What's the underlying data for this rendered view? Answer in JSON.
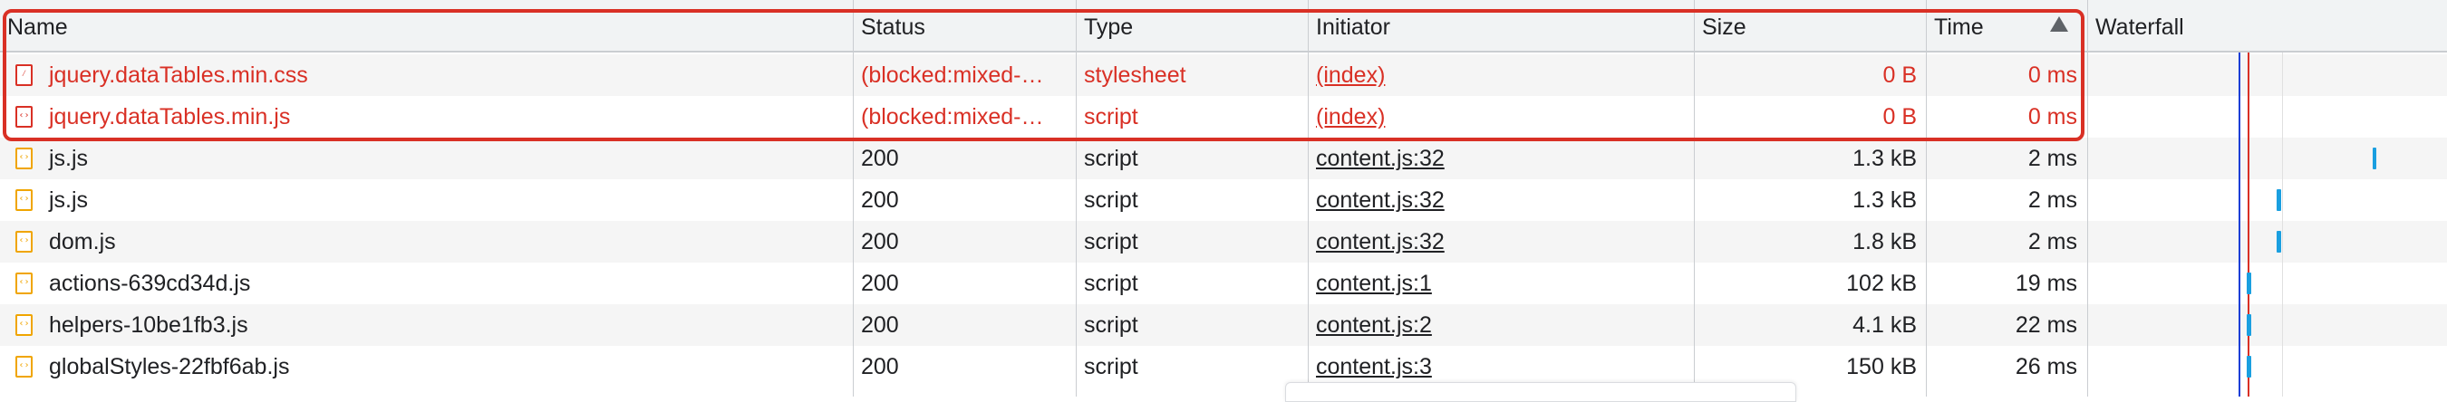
{
  "columns": {
    "name": "Name",
    "status": "Status",
    "type": "Type",
    "initiator": "Initiator",
    "size": "Size",
    "time": "Time",
    "waterfall": "Waterfall"
  },
  "rows": [
    {
      "name": "jquery.dataTables.min.css",
      "status": "(blocked:mixed-…",
      "type": "stylesheet",
      "initiator": "(index)",
      "size": "0 B",
      "time": "0 ms",
      "icon": "css-file-icon",
      "error": true
    },
    {
      "name": "jquery.dataTables.min.js",
      "status": "(blocked:mixed-…",
      "type": "script",
      "initiator": "(index)",
      "size": "0 B",
      "time": "0 ms",
      "icon": "js-file-icon",
      "error": true
    },
    {
      "name": "js.js",
      "status": "200",
      "type": "script",
      "initiator": "content.js:32",
      "size": "1.3 kB",
      "time": "2 ms",
      "icon": "js-file-icon",
      "error": false
    },
    {
      "name": "js.js",
      "status": "200",
      "type": "script",
      "initiator": "content.js:32",
      "size": "1.3 kB",
      "time": "2 ms",
      "icon": "js-file-icon",
      "error": false
    },
    {
      "name": "dom.js",
      "status": "200",
      "type": "script",
      "initiator": "content.js:32",
      "size": "1.8 kB",
      "time": "2 ms",
      "icon": "js-file-icon",
      "error": false
    },
    {
      "name": "actions-639cd34d.js",
      "status": "200",
      "type": "script",
      "initiator": "content.js:1",
      "size": "102 kB",
      "time": "19 ms",
      "icon": "js-file-icon",
      "error": false
    },
    {
      "name": "helpers-10be1fb3.js",
      "status": "200",
      "type": "script",
      "initiator": "content.js:2",
      "size": "4.1 kB",
      "time": "22 ms",
      "icon": "js-file-icon",
      "error": false
    },
    {
      "name": "globalStyles-22fbf6ab.js",
      "status": "200",
      "type": "script",
      "initiator": "content.js:3",
      "size": "150 kB",
      "time": "26 ms",
      "icon": "js-file-icon",
      "error": false
    }
  ],
  "colors": {
    "error": "#d93025",
    "icon": "#f0a500",
    "waterfall_bar": "#1a9fe0",
    "dom_content_loaded_line": "#1a3fd6",
    "load_line": "#d93025"
  },
  "sort": {
    "column": "Time",
    "direction": "ascending"
  }
}
